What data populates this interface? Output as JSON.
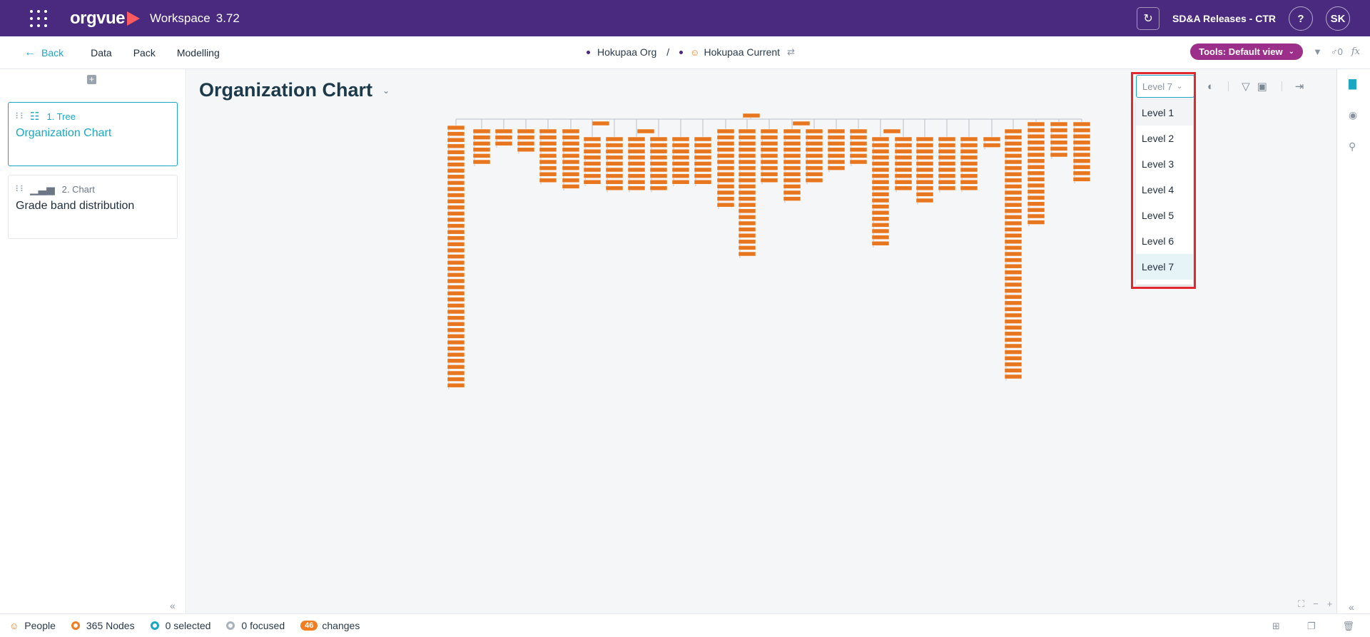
{
  "topbar": {
    "app_name": "orgvue",
    "workspace_label": "Workspace",
    "workspace_version": "3.72",
    "release_name": "SD&A Releases - CTR",
    "help_label": "?",
    "user_initials": "SK",
    "brand_color": "#4a2a7f"
  },
  "navbar": {
    "back_label": "Back",
    "links": [
      "Data",
      "Pack",
      "Modelling"
    ],
    "breadcrumb": {
      "dataset": "Hokupaa Org",
      "separator": "/",
      "view": "Hokupaa Current"
    },
    "tools_label": "Tools: Default view",
    "users_count": "0",
    "fx_label": "fx"
  },
  "sidebar": {
    "cards": [
      {
        "type_label": "1. Tree",
        "title": "Organization Chart",
        "icon": "tree-icon",
        "active": true
      },
      {
        "type_label": "2. Chart",
        "title": "Grade band distribution",
        "icon": "bar-chart-icon",
        "active": false
      }
    ]
  },
  "main": {
    "title": "Organization Chart",
    "level_select": {
      "value": "Level 7",
      "options": [
        "Level 1",
        "Level 2",
        "Level 3",
        "Level 4",
        "Level 5",
        "Level 6",
        "Level 7"
      ]
    },
    "node_color": "#e8761e",
    "highlight_color": "#e0282e"
  },
  "statusbar": {
    "people_label": "People",
    "nodes": "365 Nodes",
    "selected": "0 selected",
    "focused": "0 focused",
    "changes_count": "46",
    "changes_label": "changes"
  }
}
